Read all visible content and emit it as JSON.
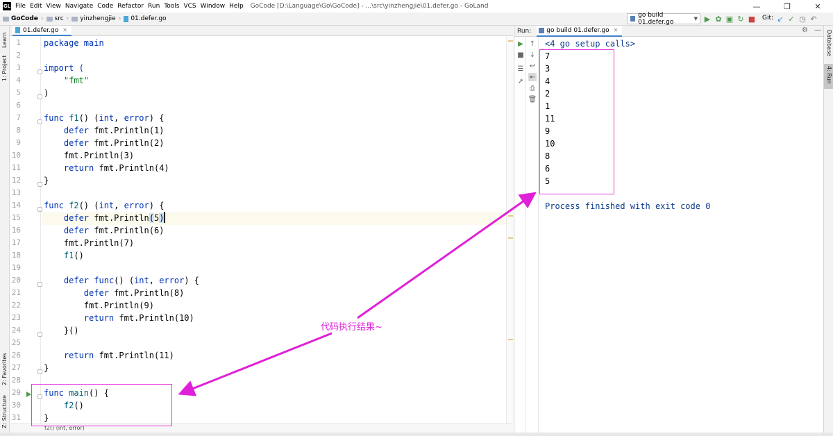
{
  "titlebar": {
    "app_icon": "goland-logo",
    "menus": [
      "File",
      "Edit",
      "View",
      "Navigate",
      "Code",
      "Refactor",
      "Run",
      "Tools",
      "VCS",
      "Window",
      "Help"
    ],
    "title": "GoCode [D:\\Language\\Go\\GoCode] - ...\\src\\yinzhengjie\\01.defer.go - GoLand",
    "controls": [
      "minimize-icon",
      "restore-icon",
      "close-icon"
    ]
  },
  "navbar": {
    "crumbs": [
      "GoCode",
      "src",
      "yinzhengjie",
      "01.defer.go"
    ],
    "run_config": "go build 01.defer.go",
    "git_label": "Git:"
  },
  "left_strip": {
    "tabs": [
      "Learn",
      "1: Project",
      "2: Favorites",
      "Z: Structure"
    ]
  },
  "right_strip": {
    "tabs": [
      "Database",
      "4: Run"
    ]
  },
  "editor": {
    "tab_label": "01.defer.go",
    "status_hint": "f2() (int, error)",
    "line_numbers": [
      "1",
      "2",
      "3",
      "4",
      "5",
      "6",
      "7",
      "8",
      "9",
      "10",
      "11",
      "12",
      "13",
      "14",
      "15",
      "16",
      "17",
      "18",
      "19",
      "20",
      "21",
      "22",
      "23",
      "24",
      "25",
      "26",
      "27",
      "28",
      "29",
      "30",
      "31"
    ],
    "lines": {
      "l1": [
        "package main"
      ],
      "l3": [
        "import ("
      ],
      "l4": [
        "    ",
        "\"fmt\""
      ],
      "l5": [
        ")"
      ],
      "l7": [
        "func ",
        "f1",
        "() (",
        "int",
        ", ",
        "error",
        ") {"
      ],
      "l8": [
        "    ",
        "defer ",
        "fmt",
        ".Println(1)"
      ],
      "l9": [
        "    ",
        "defer ",
        "fmt",
        ".Println(2)"
      ],
      "l10": [
        "    ",
        "fmt",
        ".Println(3)"
      ],
      "l11": [
        "    ",
        "return ",
        "fmt",
        ".Println(4)"
      ],
      "l12": [
        "}"
      ],
      "l14": [
        "func ",
        "f2",
        "() (",
        "int",
        ", ",
        "error",
        ") {"
      ],
      "l15": [
        "    ",
        "defer ",
        "fmt",
        ".Println",
        "(",
        "5",
        ")"
      ],
      "l16": [
        "    ",
        "defer ",
        "fmt",
        ".Println(6)"
      ],
      "l17": [
        "    ",
        "fmt",
        ".Println(7)"
      ],
      "l18": [
        "    ",
        "f1",
        "()"
      ],
      "l20": [
        "    ",
        "defer ",
        "func",
        "() (",
        "int",
        ", ",
        "error",
        ") {"
      ],
      "l21": [
        "        ",
        "defer ",
        "fmt",
        ".Println(8)"
      ],
      "l22": [
        "        ",
        "fmt",
        ".Println(9)"
      ],
      "l23": [
        "        ",
        "return ",
        "fmt",
        ".Println(10)"
      ],
      "l24": [
        "    ",
        "}()"
      ],
      "l26": [
        "    ",
        "return ",
        "fmt",
        ".Println(11)"
      ],
      "l27": [
        "}"
      ],
      "l29": [
        "func ",
        "main",
        "() {"
      ],
      "l30": [
        "    ",
        "f2",
        "()"
      ],
      "l31": [
        "}"
      ]
    }
  },
  "run_panel": {
    "label": "Run:",
    "tab_label": "go build 01.defer.go",
    "output_header": "<4 go setup calls>",
    "output_values": [
      "7",
      "3",
      "4",
      "2",
      "1",
      "11",
      "9",
      "10",
      "8",
      "6",
      "5"
    ],
    "exit_message": "Process finished with exit code 0"
  },
  "annotation": {
    "label": "代码执行结果~",
    "color": "#e020d8"
  },
  "colors": {
    "keyword": "#0033b3",
    "string": "#067d17",
    "accent": "#4083c9",
    "current_line": "#fcfaed"
  }
}
